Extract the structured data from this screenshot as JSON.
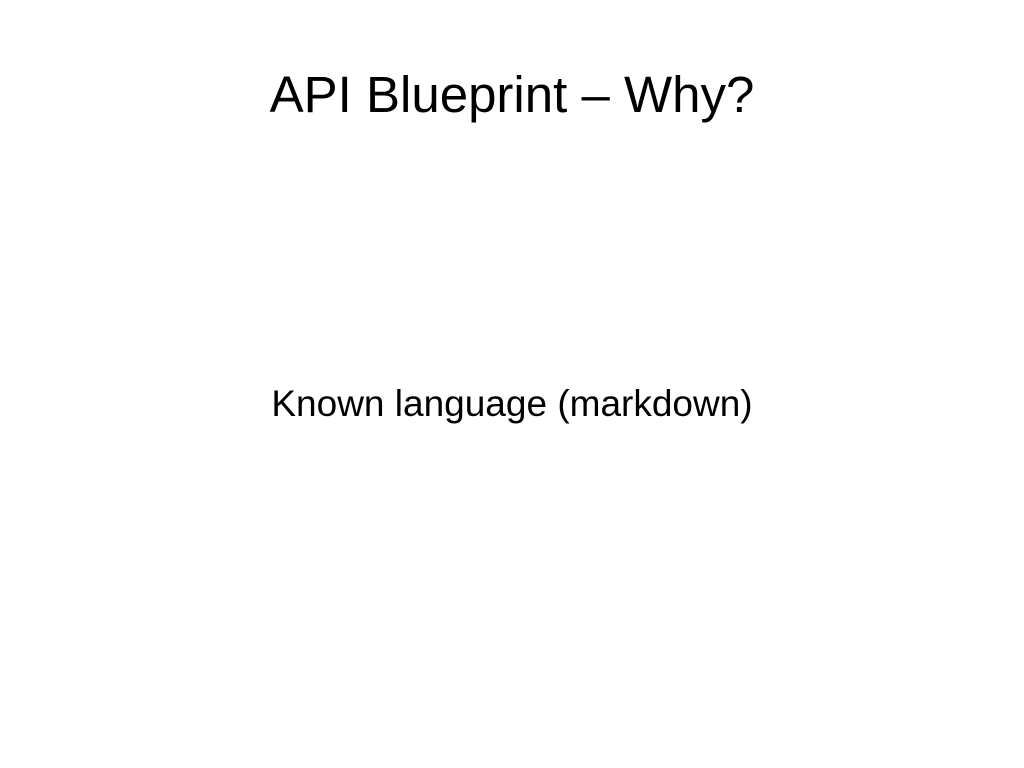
{
  "slide": {
    "title": "API Blueprint – Why?",
    "body": "Known language (markdown)"
  }
}
